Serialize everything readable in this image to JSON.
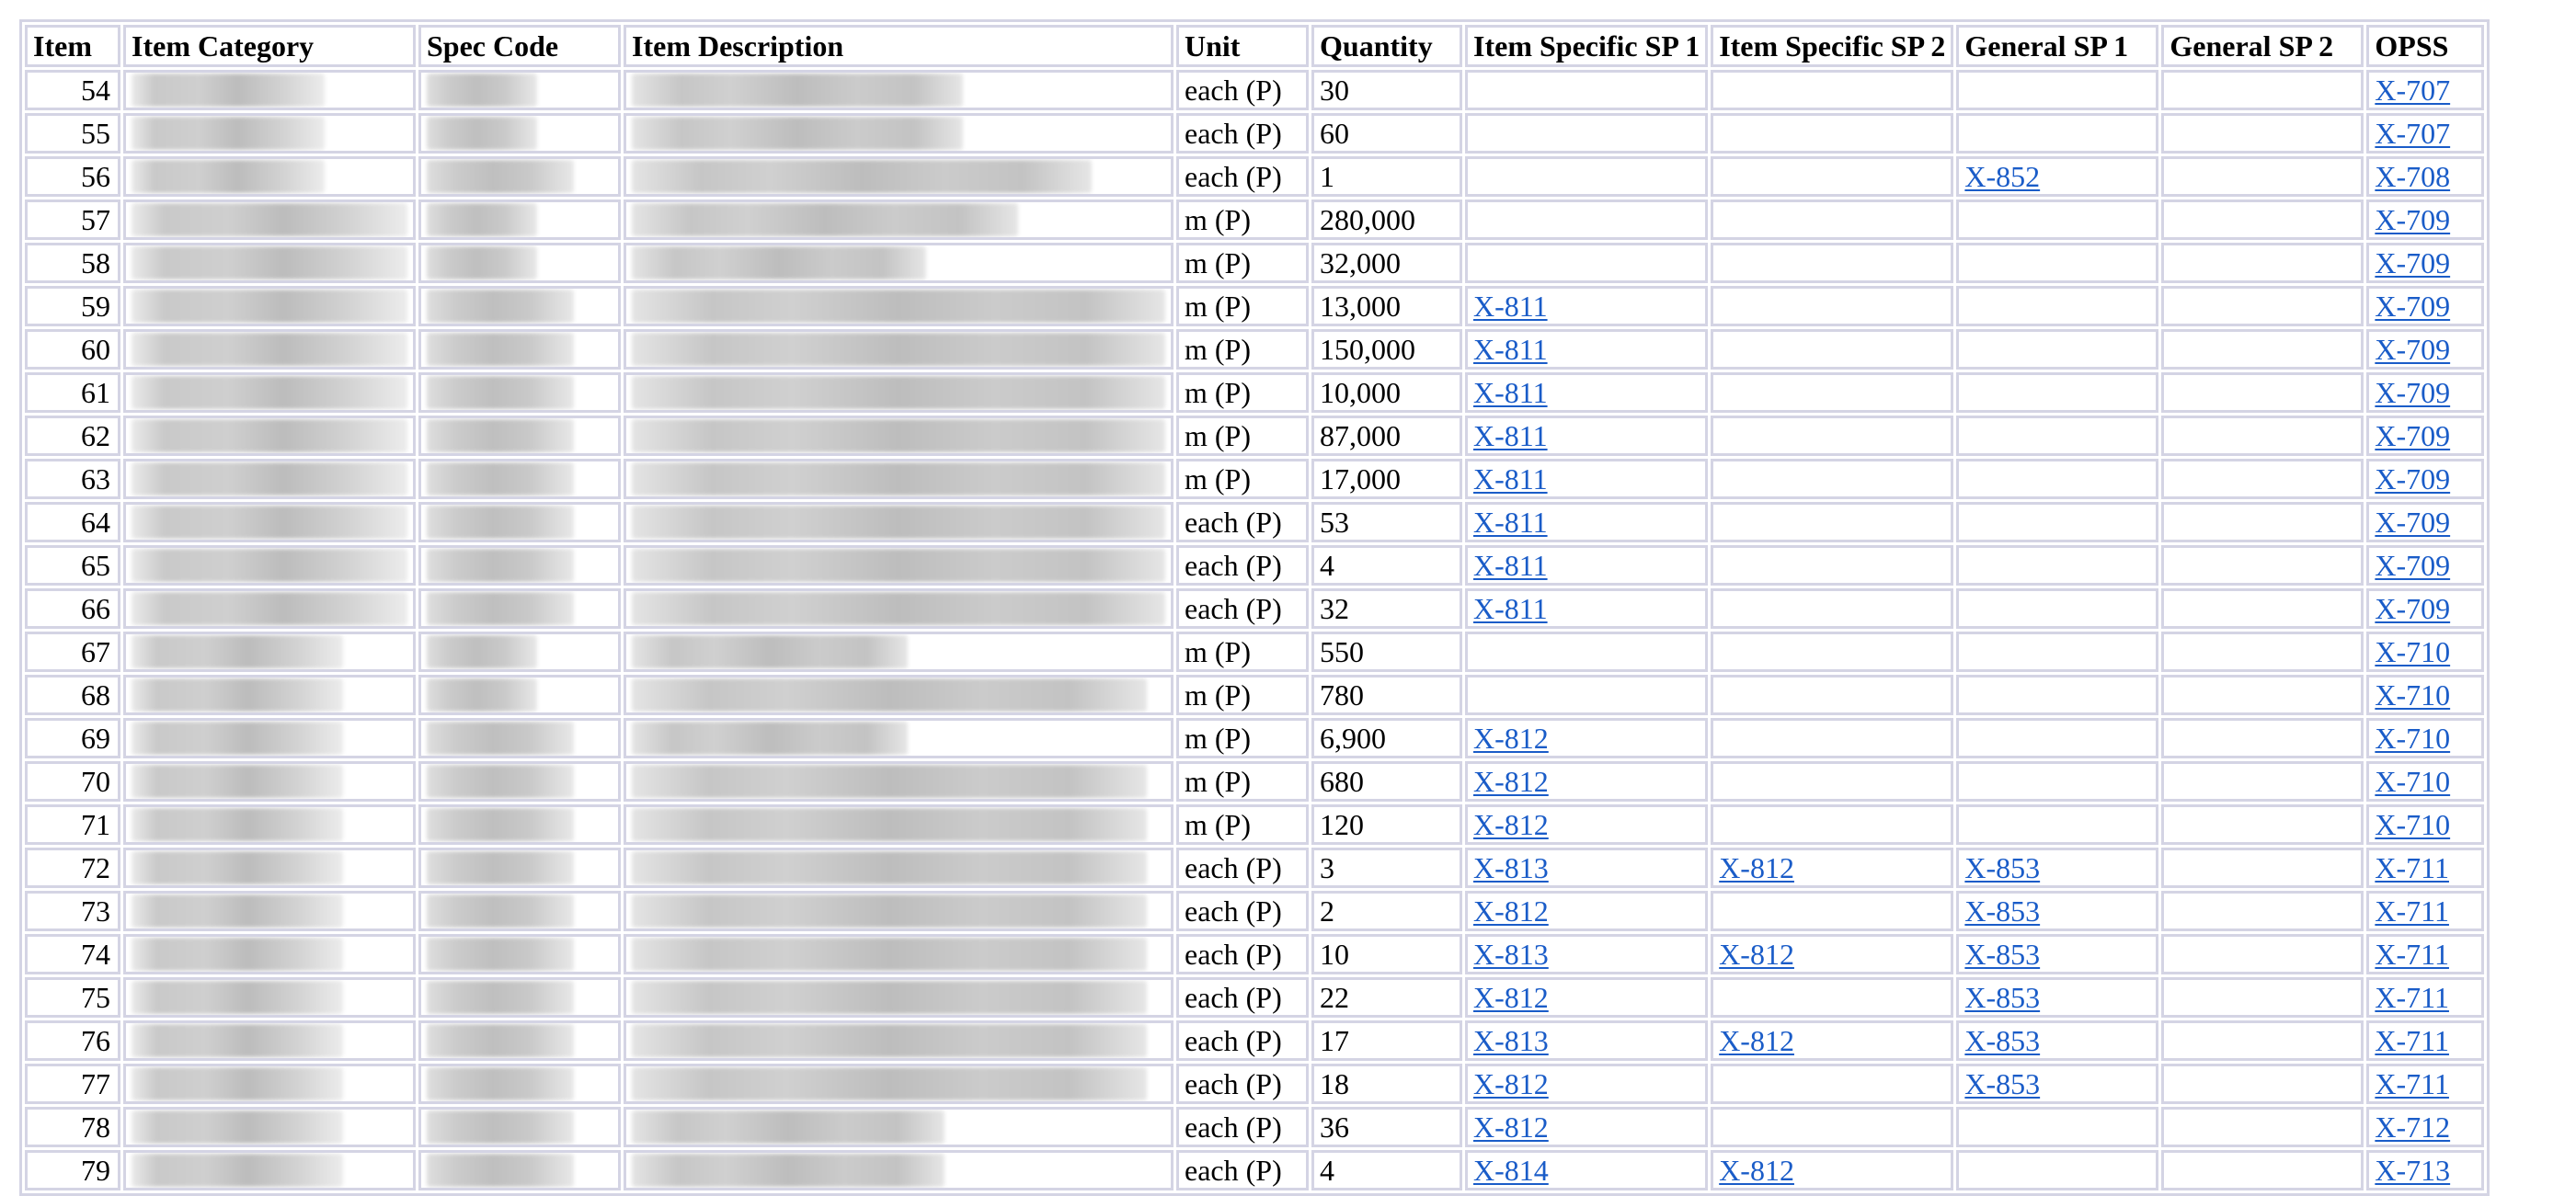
{
  "headers": [
    "Item",
    "Item Category",
    "Spec Code",
    "Item Description",
    "Unit",
    "Quantity",
    "Item Specific SP 1",
    "Item Specific SP 2",
    "General SP 1",
    "General SP 2",
    "OPSS"
  ],
  "rows": [
    {
      "item": "54",
      "unit": "each (P)",
      "quantity": "30",
      "isp1": "",
      "isp2": "",
      "gsp1": "",
      "gsp2": "",
      "opss": "X-707"
    },
    {
      "item": "55",
      "unit": "each (P)",
      "quantity": "60",
      "isp1": "",
      "isp2": "",
      "gsp1": "",
      "gsp2": "",
      "opss": "X-707"
    },
    {
      "item": "56",
      "unit": "each (P)",
      "quantity": "1",
      "isp1": "",
      "isp2": "",
      "gsp1": "X-852",
      "gsp2": "",
      "opss": "X-708"
    },
    {
      "item": "57",
      "unit": "m (P)",
      "quantity": "280,000",
      "isp1": "",
      "isp2": "",
      "gsp1": "",
      "gsp2": "",
      "opss": "X-709"
    },
    {
      "item": "58",
      "unit": "m (P)",
      "quantity": "32,000",
      "isp1": "",
      "isp2": "",
      "gsp1": "",
      "gsp2": "",
      "opss": "X-709"
    },
    {
      "item": "59",
      "unit": "m (P)",
      "quantity": "13,000",
      "isp1": "X-811",
      "isp2": "",
      "gsp1": "",
      "gsp2": "",
      "opss": "X-709"
    },
    {
      "item": "60",
      "unit": "m (P)",
      "quantity": "150,000",
      "isp1": "X-811",
      "isp2": "",
      "gsp1": "",
      "gsp2": "",
      "opss": "X-709"
    },
    {
      "item": "61",
      "unit": "m (P)",
      "quantity": "10,000",
      "isp1": "X-811",
      "isp2": "",
      "gsp1": "",
      "gsp2": "",
      "opss": "X-709"
    },
    {
      "item": "62",
      "unit": "m (P)",
      "quantity": "87,000",
      "isp1": "X-811",
      "isp2": "",
      "gsp1": "",
      "gsp2": "",
      "opss": "X-709"
    },
    {
      "item": "63",
      "unit": "m (P)",
      "quantity": "17,000",
      "isp1": "X-811",
      "isp2": "",
      "gsp1": "",
      "gsp2": "",
      "opss": "X-709"
    },
    {
      "item": "64",
      "unit": "each (P)",
      "quantity": "53",
      "isp1": "X-811",
      "isp2": "",
      "gsp1": "",
      "gsp2": "",
      "opss": "X-709"
    },
    {
      "item": "65",
      "unit": "each (P)",
      "quantity": "4",
      "isp1": "X-811",
      "isp2": "",
      "gsp1": "",
      "gsp2": "",
      "opss": "X-709"
    },
    {
      "item": "66",
      "unit": "each (P)",
      "quantity": "32",
      "isp1": "X-811",
      "isp2": "",
      "gsp1": "",
      "gsp2": "",
      "opss": "X-709"
    },
    {
      "item": "67",
      "unit": "m (P)",
      "quantity": "550",
      "isp1": "",
      "isp2": "",
      "gsp1": "",
      "gsp2": "",
      "opss": "X-710"
    },
    {
      "item": "68",
      "unit": "m (P)",
      "quantity": "780",
      "isp1": "",
      "isp2": "",
      "gsp1": "",
      "gsp2": "",
      "opss": "X-710"
    },
    {
      "item": "69",
      "unit": "m (P)",
      "quantity": "6,900",
      "isp1": "X-812",
      "isp2": "",
      "gsp1": "",
      "gsp2": "",
      "opss": "X-710"
    },
    {
      "item": "70",
      "unit": "m (P)",
      "quantity": "680",
      "isp1": "X-812",
      "isp2": "",
      "gsp1": "",
      "gsp2": "",
      "opss": "X-710"
    },
    {
      "item": "71",
      "unit": "m (P)",
      "quantity": "120",
      "isp1": "X-812",
      "isp2": "",
      "gsp1": "",
      "gsp2": "",
      "opss": "X-710"
    },
    {
      "item": "72",
      "unit": "each (P)",
      "quantity": "3",
      "isp1": "X-813",
      "isp2": "X-812",
      "gsp1": "X-853",
      "gsp2": "",
      "opss": "X-711"
    },
    {
      "item": "73",
      "unit": "each (P)",
      "quantity": "2",
      "isp1": "X-812",
      "isp2": "",
      "gsp1": "X-853",
      "gsp2": "",
      "opss": "X-711"
    },
    {
      "item": "74",
      "unit": "each (P)",
      "quantity": "10",
      "isp1": "X-813",
      "isp2": "X-812",
      "gsp1": "X-853",
      "gsp2": "",
      "opss": "X-711"
    },
    {
      "item": "75",
      "unit": "each (P)",
      "quantity": "22",
      "isp1": "X-812",
      "isp2": "",
      "gsp1": "X-853",
      "gsp2": "",
      "opss": "X-711"
    },
    {
      "item": "76",
      "unit": "each (P)",
      "quantity": "17",
      "isp1": "X-813",
      "isp2": "X-812",
      "gsp1": "X-853",
      "gsp2": "",
      "opss": "X-711"
    },
    {
      "item": "77",
      "unit": "each (P)",
      "quantity": "18",
      "isp1": "X-812",
      "isp2": "",
      "gsp1": "X-853",
      "gsp2": "",
      "opss": "X-711"
    },
    {
      "item": "78",
      "unit": "each (P)",
      "quantity": "36",
      "isp1": "X-812",
      "isp2": "",
      "gsp1": "",
      "gsp2": "",
      "opss": "X-712"
    },
    {
      "item": "79",
      "unit": "each (P)",
      "quantity": "4",
      "isp1": "X-814",
      "isp2": "X-812",
      "gsp1": "",
      "gsp2": "",
      "opss": "X-713"
    }
  ]
}
